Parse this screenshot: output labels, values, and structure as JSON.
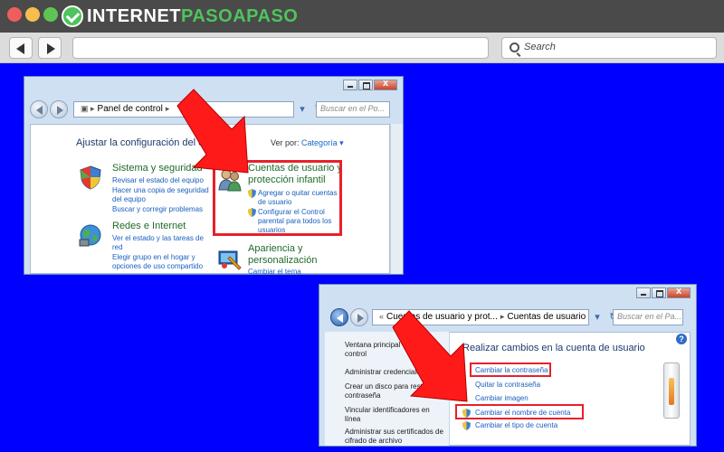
{
  "brand": {
    "part1": "INTERNET",
    "part2": "PASOAPASO"
  },
  "browser": {
    "search_placeholder": "Search"
  },
  "win1": {
    "breadcrumb": "Panel de control",
    "search_placeholder": "Buscar en el Po...",
    "heading": "Ajustar la configuración del equipo",
    "view_by_label": "Ver por:",
    "view_by_value": "Categoría",
    "categories": [
      {
        "title": "Sistema y seguridad",
        "links": [
          "Revisar el estado del equipo",
          "Hacer una copia de seguridad",
          "del equipo",
          "Buscar y corregir problemas"
        ]
      },
      {
        "title": "Redes e Internet",
        "links": [
          "Ver el estado y las tareas de",
          "red",
          "Elegir grupo en el hogar y",
          "opciones de uso compartido"
        ]
      },
      {
        "title_line1": "Cuentas de usuario y",
        "title_line2": "protección infantil",
        "links": [
          "Agregar o quitar cuentas",
          "de usuario",
          "Configurar el Control",
          "parental para todos los",
          "usuarios"
        ]
      },
      {
        "title_line1": "Apariencia y",
        "title_line2": "personalización",
        "links": [
          "Cambiar el tema"
        ]
      }
    ]
  },
  "win2": {
    "breadcrumb_1": "Cuentas de usuario y prot...",
    "breadcrumb_2": "Cuentas de usuario",
    "search_placeholder": "Buscar en el Pa...",
    "left_pane": [
      "Ventana principal",
      "control",
      "Administrar credenciales",
      "Crear un disco para restab.",
      "contraseña",
      "Vincular identificadores en",
      "línea",
      "Administrar sus certificados de",
      "cifrado de archivo"
    ],
    "title": "Realizar cambios en la cuenta de usuario",
    "links": [
      "Cambiar la contraseña",
      "Quitar la contraseña",
      "Cambiar imagen",
      "Cambiar el nombre de cuenta",
      "Cambiar el tipo de cuenta"
    ],
    "help": "?"
  },
  "colors": {
    "background": "#0000ff",
    "highlight": "#e8202a",
    "link": "#1a5fbf",
    "category": "#1e6a2a"
  }
}
